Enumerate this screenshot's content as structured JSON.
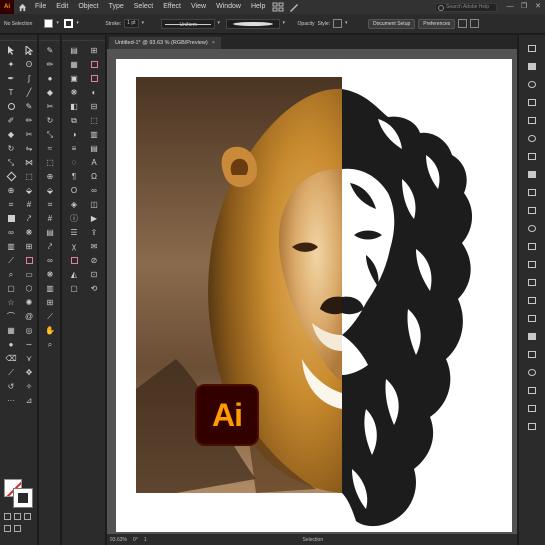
{
  "app": {
    "logo": "Ai"
  },
  "menu": [
    "File",
    "Edit",
    "Object",
    "Type",
    "Select",
    "Effect",
    "View",
    "Window",
    "Help"
  ],
  "search": {
    "placeholder": "Search Adobe Help"
  },
  "window_controls": {
    "minimize": "—",
    "maximize": "❐",
    "close": "✕"
  },
  "control_bar": {
    "selection": "No Selection",
    "stroke_label": "Stroke:",
    "stroke_weight": "1 pt",
    "brush": "Uniform",
    "opacity_label": "Opacity",
    "style_label": "Style:",
    "document_setup": "Document Setup",
    "preferences": "Preferences"
  },
  "document": {
    "tab_title": "Untitled-1* @ 93.63 % (RGB/Preview)",
    "close": "×"
  },
  "status": {
    "zoom": "93.63%",
    "rotation": "0°",
    "page": "1",
    "mode": "Selection"
  },
  "overlay": {
    "badge": "Ai"
  },
  "colors": {
    "accent": "#ff9a00",
    "badge_bg": "#330000",
    "artboard": "#ffffff",
    "canvas": "#535353",
    "ui": "#2b2b2b"
  }
}
